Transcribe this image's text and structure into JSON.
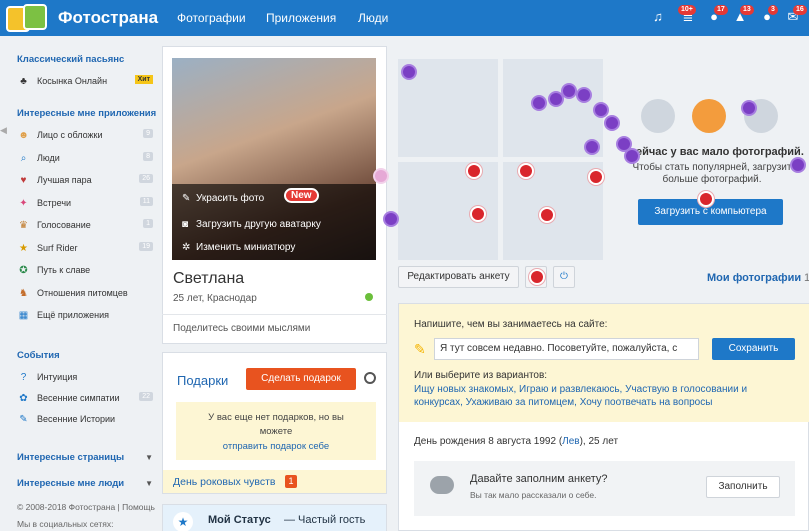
{
  "header": {
    "brand": "Фотострана",
    "nav": [
      "Фотографии",
      "Приложения",
      "Люди"
    ],
    "badges": {
      "b1": "10+",
      "b2": "17",
      "b3": "13",
      "b4": "3",
      "b5": "16"
    }
  },
  "sidebar": {
    "sec1": "Классический пасьянс",
    "game": "Косынка Онлайн",
    "hit": "Хит",
    "sec2": "Интересные мне приложения",
    "apps": [
      {
        "label": "Лицо с обложки",
        "count": "9",
        "icon": "face-icon"
      },
      {
        "label": "Люди",
        "count": "8",
        "icon": "search-icon"
      },
      {
        "label": "Лучшая пара",
        "count": "26",
        "icon": "heart-icon"
      },
      {
        "label": "Встречи",
        "count": "11",
        "icon": "meet-icon"
      },
      {
        "label": "Голосование",
        "count": "1",
        "icon": "vote-icon"
      },
      {
        "label": "Surf Rider",
        "count": "19",
        "icon": "star-icon"
      },
      {
        "label": "Путь к славе",
        "count": "",
        "icon": "fame-icon"
      },
      {
        "label": "Отношения питомцев",
        "count": "",
        "icon": "pet-icon"
      },
      {
        "label": "Ещё приложения",
        "count": "",
        "icon": "apps-icon"
      }
    ],
    "sec3": "События",
    "events": [
      {
        "label": "Интуиция",
        "count": ""
      },
      {
        "label": "Весенние симпатии",
        "count": "22"
      },
      {
        "label": "Весенние Истории",
        "count": ""
      }
    ],
    "sec4": "Интересные страницы",
    "sec5": "Интересные мне люди",
    "footer1": "© 2008-2018 Фотострана | Помощь",
    "footer2": "Мы в социальных сетях:"
  },
  "profile": {
    "decorate": "Украсить фото",
    "new": "New",
    "upload_avatar": "Загрузить другую аватарку",
    "change_thumb": "Изменить миниатюру",
    "name": "Светлана",
    "meta": "25 лет, Краснодар",
    "status_ph": "Поделитесь своими мыслями"
  },
  "gifts": {
    "title": "Подарки",
    "btn": "Сделать подарок",
    "empty1": "У вас еще нет подарков, но вы",
    "empty2": "можете",
    "send_self": "отправить подарок себе",
    "day": "День роковых чувств",
    "day_count": "1",
    "my_status": "Мой Статус",
    "my_status_val": "— Частый гость"
  },
  "photos": {
    "few": "ейчас у вас мало фотографий.",
    "hint1": "Чтобы стать популярней, загрузит",
    "hint2": "больше фотографий.",
    "upload_btn": "Загрузить с компьютера",
    "edit_btn": "Редактировать анкету",
    "my_photos": "Мои фотографии",
    "my_photos_count": "1"
  },
  "about": {
    "prompt": "Напишите, чем вы занимаетесь на сайте:",
    "value": "Я тут совсем недавно. Посоветуйте, пожалуйста, с",
    "save": "Сохранить",
    "or": "Или выберите из вариантов:",
    "options1": "Ищу новых знакомых, Играю и развлекаюсь, Участвую в голосовании и",
    "options2": "конкурсах, Ухаживаю за питомцем, Хочу поотвечать на вопросы",
    "birthday_pre": "День рождения 8 августа 1992 (",
    "sign": "Лев",
    "birthday_post": "), 25 лет",
    "fill_title": "Давайте заполним анкету?",
    "fill_sub": "Вы так мало рассказали о себе.",
    "fill_btn": "Заполнить"
  },
  "colors": {
    "brand": "#1e78c8",
    "accent": "#e8531f",
    "link": "#2067b1"
  }
}
